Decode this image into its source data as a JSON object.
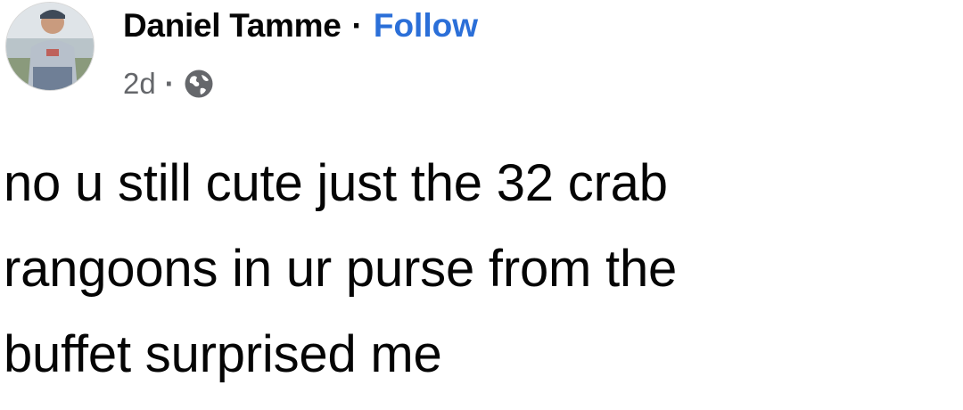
{
  "post": {
    "author": {
      "name": "Daniel Tamme",
      "separator": "·",
      "follow_label": "Follow"
    },
    "meta": {
      "time": "2d",
      "separator": "·",
      "audience_icon": "globe-icon"
    },
    "text": "no u still cute just the 32 crab\nrangoons in ur purse from the\nbuffet surprised me"
  },
  "colors": {
    "follow_link": "#2b6fd8",
    "meta_text": "#65676b",
    "body_text": "#050505"
  }
}
